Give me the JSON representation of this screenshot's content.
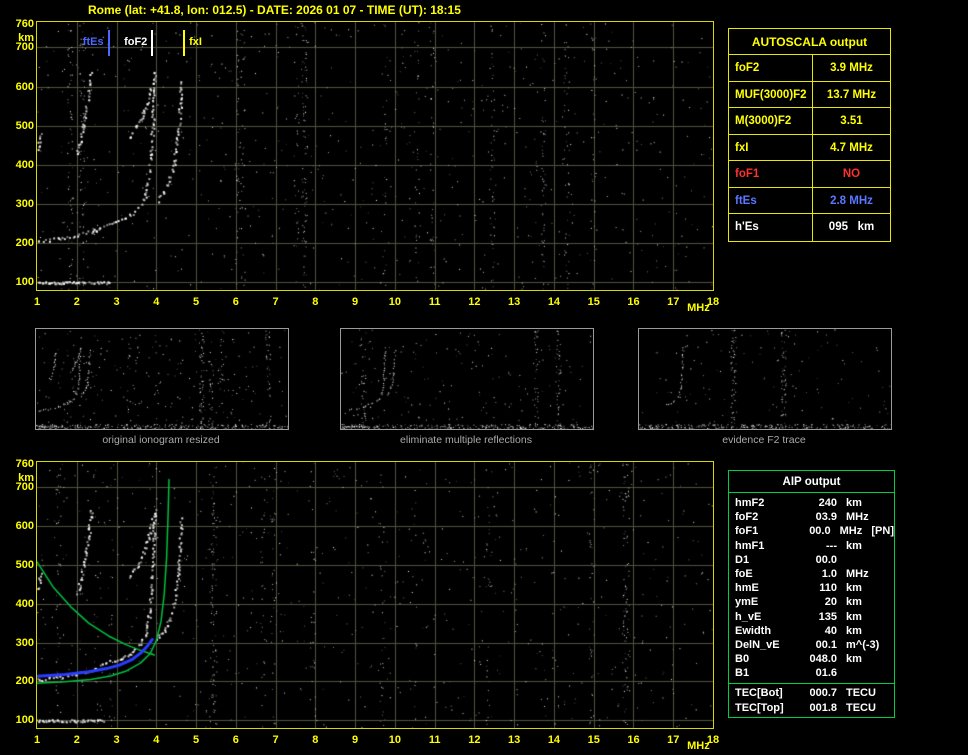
{
  "header": {
    "title": "Rome (lat: +41.8, lon: 012.5) - DATE: 2026 01 07 - TIME (UT): 18:15"
  },
  "autoscala_table": {
    "title": "AUTOSCALA output",
    "rows": [
      {
        "label": "foF2",
        "value": "3.9 MHz",
        "color": "#ffff00"
      },
      {
        "label": "MUF(3000)F2",
        "value": "13.7 MHz",
        "color": "#ffff00"
      },
      {
        "label": "M(3000)F2",
        "value": "3.51",
        "color": "#ffff00"
      },
      {
        "label": "fxI",
        "value": "4.7 MHz",
        "color": "#ffff00"
      },
      {
        "label": "foF1",
        "value": "NO",
        "color": "#ff3030"
      },
      {
        "label": "ftEs",
        "value": "2.8 MHz",
        "color": "#5b76ff"
      },
      {
        "label": "h'Es",
        "value": "095   km",
        "color": "#ffffff"
      }
    ]
  },
  "thumbnails": [
    {
      "caption": "original ionogram resized"
    },
    {
      "caption": "eliminate multiple reflections"
    },
    {
      "caption": "evidence F2 trace"
    }
  ],
  "aip_table": {
    "title": "AIP output",
    "rows": [
      {
        "label": "hmF2",
        "value": "240",
        "unit": "km"
      },
      {
        "label": "foF2",
        "value": "03.9",
        "unit": "MHz"
      },
      {
        "label": "foF1",
        "value": "00.0",
        "unit": "MHz   [PN]"
      },
      {
        "label": "hmF1",
        "value": "---",
        "unit": "km"
      },
      {
        "label": "D1",
        "value": "00.0",
        "unit": ""
      },
      {
        "label": "foE",
        "value": "1.0",
        "unit": "MHz"
      },
      {
        "label": "hmE",
        "value": "110",
        "unit": "km"
      },
      {
        "label": "ymE",
        "value": "20",
        "unit": "km"
      },
      {
        "label": "h_vE",
        "value": "135",
        "unit": "km"
      },
      {
        "label": "Ewidth",
        "value": "40",
        "unit": "km"
      },
      {
        "label": "DelN_vE",
        "value": "00.1",
        "unit": "m^(-3)"
      },
      {
        "label": "B0",
        "value": "048.0",
        "unit": "km"
      },
      {
        "label": "B1",
        "value": "01.6",
        "unit": ""
      }
    ],
    "tec_rows": [
      {
        "label": "TEC[Bot]",
        "value": "000.7",
        "unit": "TECU"
      },
      {
        "label": "TEC[Top]",
        "value": "001.8",
        "unit": "TECU"
      }
    ]
  },
  "chart_data": {
    "type": "scatter",
    "title": "ionogram echoes (virtual height vs frequency)",
    "x_axis": {
      "label": "MHz",
      "min": 1,
      "max": 18,
      "ticks": [
        1,
        2,
        3,
        4,
        5,
        6,
        7,
        8,
        9,
        10,
        11,
        12,
        13,
        14,
        15,
        16,
        17,
        18
      ]
    },
    "y_axis": {
      "label": "km",
      "min": 80,
      "max": 765,
      "ticks": [
        760,
        700,
        600,
        500,
        400,
        300,
        200,
        100
      ]
    },
    "grid_color": "#53533f",
    "markers": [
      {
        "label": "ftEs",
        "freq": 2.8,
        "color": "#4a6aff",
        "side": "left"
      },
      {
        "label": "foF2",
        "freq": 3.9,
        "color": "#ffffff",
        "side": "left"
      },
      {
        "label": "fxI",
        "freq": 4.7,
        "color": "#ffff00",
        "side": "right"
      }
    ],
    "scaled_values": {
      "foF2_MHz": 3.9,
      "MUF3000F2_MHz": 13.7,
      "M3000F2": 3.51,
      "fxI_MHz": 4.7,
      "foF1": "NO",
      "ftEs_MHz": 2.8,
      "hEs_km": 95
    },
    "traces": {
      "es": {
        "style": "dots",
        "size": 2,
        "jitter": 2.5,
        "step": 1.3,
        "points": [
          [
            1.0,
            100
          ],
          [
            2.78,
            100
          ]
        ]
      },
      "lowF": {
        "style": "dots",
        "points": [
          [
            1.0,
            206
          ],
          [
            1.5,
            212
          ],
          [
            2.0,
            221
          ],
          [
            2.45,
            233
          ],
          [
            2.8,
            250
          ]
        ]
      },
      "chainA": {
        "style": "dots",
        "points": [
          [
            2.8,
            250
          ],
          [
            3.1,
            260
          ],
          [
            3.35,
            273
          ],
          [
            3.55,
            292
          ],
          [
            3.7,
            322
          ],
          [
            3.8,
            368
          ],
          [
            3.86,
            430
          ],
          [
            3.9,
            505
          ],
          [
            3.93,
            585
          ],
          [
            3.95,
            640
          ]
        ]
      },
      "chainB": {
        "style": "dots",
        "points": [
          [
            4.02,
            310
          ],
          [
            4.18,
            332
          ],
          [
            4.32,
            362
          ],
          [
            4.44,
            405
          ],
          [
            4.52,
            465
          ],
          [
            4.58,
            540
          ],
          [
            4.62,
            620
          ]
        ]
      },
      "hop2a": {
        "style": "dots",
        "points": [
          [
            2.0,
            428
          ],
          [
            2.08,
            462
          ],
          [
            2.16,
            502
          ],
          [
            2.24,
            548
          ],
          [
            2.31,
            598
          ],
          [
            2.36,
            638
          ]
        ]
      },
      "hop2b": {
        "style": "dots",
        "points": [
          [
            3.3,
            468
          ],
          [
            3.5,
            498
          ],
          [
            3.68,
            538
          ],
          [
            3.83,
            585
          ],
          [
            3.93,
            632
          ]
        ]
      },
      "clump": {
        "style": "dots",
        "points": [
          [
            1.02,
            440
          ],
          [
            1.08,
            478
          ]
        ]
      },
      "profile_line": {
        "style": "line",
        "color": "#00c040",
        "width": 1.5,
        "points": [
          [
            1.0,
            508
          ],
          [
            1.4,
            444
          ],
          [
            1.85,
            392
          ],
          [
            2.3,
            350
          ],
          [
            2.8,
            317
          ],
          [
            3.25,
            294
          ],
          [
            3.6,
            280
          ],
          [
            3.95,
            268
          ]
        ]
      },
      "model_line": {
        "style": "line",
        "color": "#00c040",
        "width": 1.5,
        "points": [
          [
            1.0,
            195
          ],
          [
            1.7,
            199
          ],
          [
            2.35,
            205
          ],
          [
            2.85,
            214
          ],
          [
            3.25,
            227
          ],
          [
            3.6,
            247
          ],
          [
            3.85,
            272
          ],
          [
            4.0,
            305
          ],
          [
            4.12,
            355
          ],
          [
            4.2,
            425
          ],
          [
            4.26,
            520
          ],
          [
            4.3,
            640
          ],
          [
            4.32,
            720
          ]
        ]
      },
      "restored_line": {
        "style": "line",
        "color": "#2a3cff",
        "width": 3,
        "points": [
          [
            1.0,
            213
          ],
          [
            1.7,
            218
          ],
          [
            2.3,
            225
          ],
          [
            2.75,
            233
          ],
          [
            3.1,
            243
          ],
          [
            3.4,
            257
          ],
          [
            3.62,
            274
          ],
          [
            3.8,
            294
          ],
          [
            3.9,
            308
          ]
        ]
      }
    },
    "plots": {
      "top": {
        "seed": 7,
        "grid": true,
        "markers": true,
        "noise": 700,
        "bands": 14,
        "traces": [
          "es",
          "lowF",
          "chainA",
          "chainB",
          "hop2a",
          "hop2b",
          "clump"
        ]
      },
      "bottom": {
        "seed": 13,
        "grid": true,
        "noise": 700,
        "bands": 14,
        "traces": [
          "es",
          "lowF",
          "chainA",
          "chainB",
          "hop2a",
          "hop2b",
          "clump",
          "profile_line",
          "model_line",
          "restored_line"
        ]
      },
      "thumbs": [
        {
          "seed": 21,
          "noise": 230,
          "bands": 5,
          "bottomBand": true,
          "dotScale": 0.55,
          "traces": [
            "es",
            "lowF",
            "chainA",
            "chainB",
            "hop2a",
            "hop2b"
          ]
        },
        {
          "seed": 22,
          "noise": 170,
          "bands": 3,
          "bottomBand": true,
          "dotScale": 0.55,
          "traces": [
            "es",
            "lowF",
            "chainA",
            "chainB"
          ]
        },
        {
          "seed": 23,
          "noise": 120,
          "bands": 2,
          "bottomBand": true,
          "dotScale": 0.55,
          "traces": [
            "chainA"
          ]
        }
      ]
    }
  }
}
